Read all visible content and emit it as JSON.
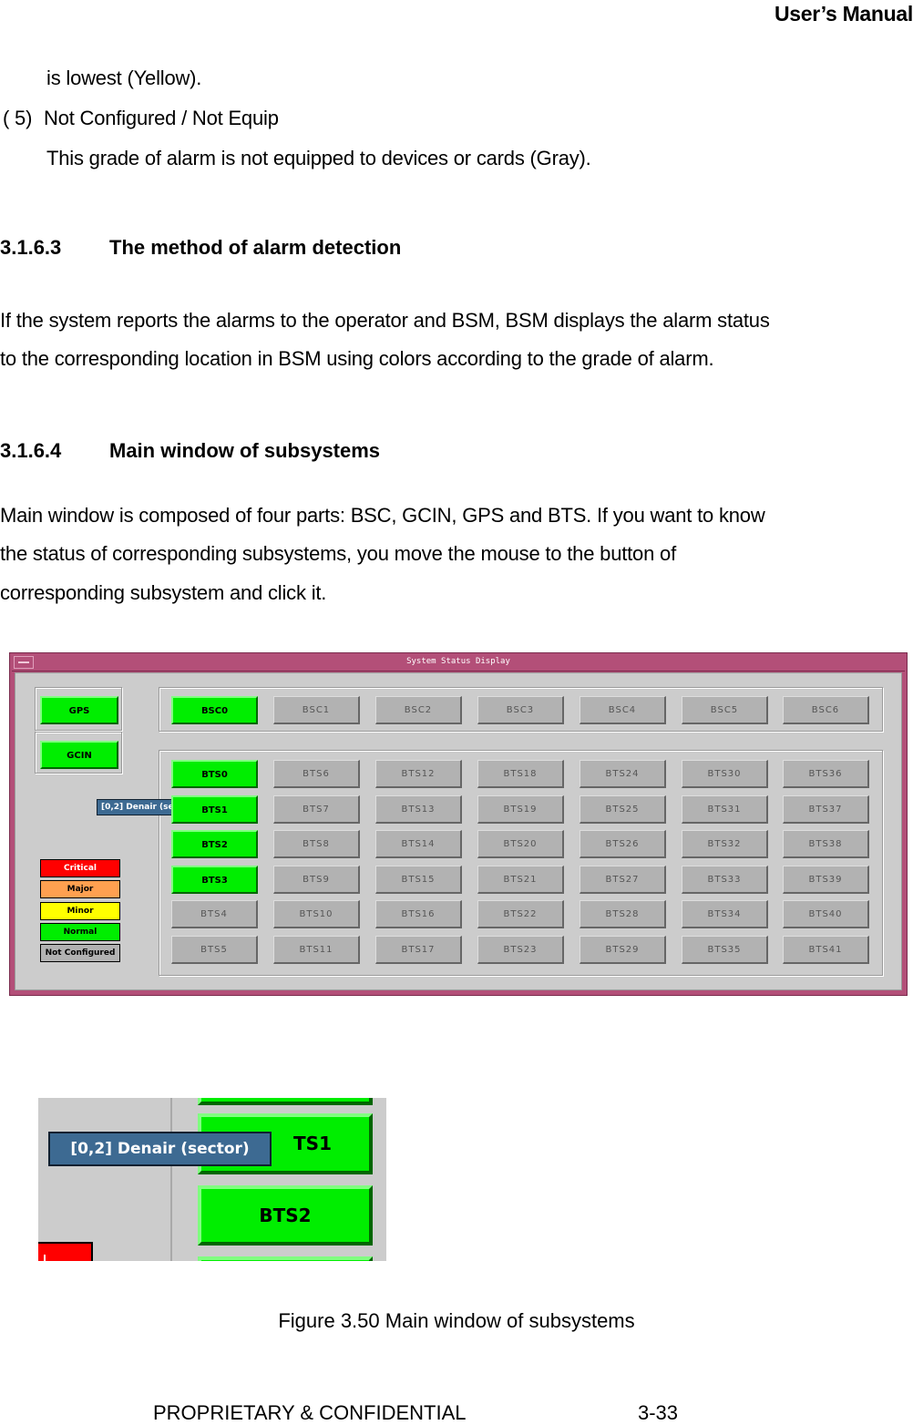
{
  "header": {
    "title": "User’s Manual"
  },
  "intro": {
    "line1": "is lowest (Yellow).",
    "item5_num": "( 5)",
    "item5_label": "Not Configured / Not Equip",
    "item5_desc": "This grade of alarm is not equipped to devices or cards (Gray)."
  },
  "section_3163": {
    "number": "3.1.6.3",
    "title": "The method of alarm detection",
    "lines": [
      "If the system reports the alarms to the operator and BSM, BSM displays the alarm status",
      "to the corresponding location in BSM using colors according to the grade of alarm."
    ]
  },
  "section_3164": {
    "number": "3.1.6.4",
    "title": "Main window of subsystems",
    "lines": [
      "Main window is composed of four parts: BSC, GCIN, GPS and BTS. If you want to know",
      "the status of corresponding subsystems, you move the mouse to the button of",
      "corresponding subsystem and click it."
    ]
  },
  "window": {
    "title": "System Status Display",
    "gps": {
      "label": "GPS",
      "status": "normal"
    },
    "gcin": {
      "label": "GCIN",
      "status": "normal"
    },
    "bsc": [
      {
        "label": "BSC0",
        "status": "normal"
      },
      {
        "label": "BSC1",
        "status": "not-configured"
      },
      {
        "label": "BSC2",
        "status": "not-configured"
      },
      {
        "label": "BSC3",
        "status": "not-configured"
      },
      {
        "label": "BSC4",
        "status": "not-configured"
      },
      {
        "label": "BSC5",
        "status": "not-configured"
      },
      {
        "label": "BSC6",
        "status": "not-configured"
      }
    ],
    "bts_columns": [
      [
        "BTS0",
        "BTS1",
        "BTS2",
        "BTS3",
        "BTS4",
        "BTS5"
      ],
      [
        "BTS6",
        "BTS7",
        "BTS8",
        "BTS9",
        "BTS10",
        "BTS11"
      ],
      [
        "BTS12",
        "BTS13",
        "BTS14",
        "BTS15",
        "BTS16",
        "BTS17"
      ],
      [
        "BTS18",
        "BTS19",
        "BTS20",
        "BTS21",
        "BTS22",
        "BTS23"
      ],
      [
        "BTS24",
        "BTS25",
        "BTS26",
        "BTS27",
        "BTS28",
        "BTS29"
      ],
      [
        "BTS30",
        "BTS31",
        "BTS32",
        "BTS33",
        "BTS34",
        "BTS35"
      ],
      [
        "BTS36",
        "BTS37",
        "BTS38",
        "BTS39",
        "BTS40",
        "BTS41"
      ]
    ],
    "bts_normal": [
      "BTS0",
      "BTS1",
      "BTS2",
      "BTS3"
    ],
    "tooltip": "[0,2] Denair (sector)",
    "legend": [
      {
        "label": "Critical",
        "bg": "#ff0000",
        "fg": "#ffffff"
      },
      {
        "label": "Major",
        "bg": "#ffa050",
        "fg": "#000000"
      },
      {
        "label": "Minor",
        "bg": "#ffff00",
        "fg": "#000000"
      },
      {
        "label": "Normal",
        "bg": "#00ee00",
        "fg": "#000000"
      },
      {
        "label": "Not Configured",
        "bg": "#b2b2b2",
        "fg": "#000000"
      }
    ]
  },
  "zoom_detail": {
    "tooltip": "[0,2] Denair (sector)",
    "btn_bts1_partial": "TS1",
    "btn_bts2": "BTS2"
  },
  "caption": "Figure 3.50 Main window of subsystems",
  "footer": {
    "left": "PROPRIETARY & CONFIDENTIAL",
    "right": "3-33"
  }
}
